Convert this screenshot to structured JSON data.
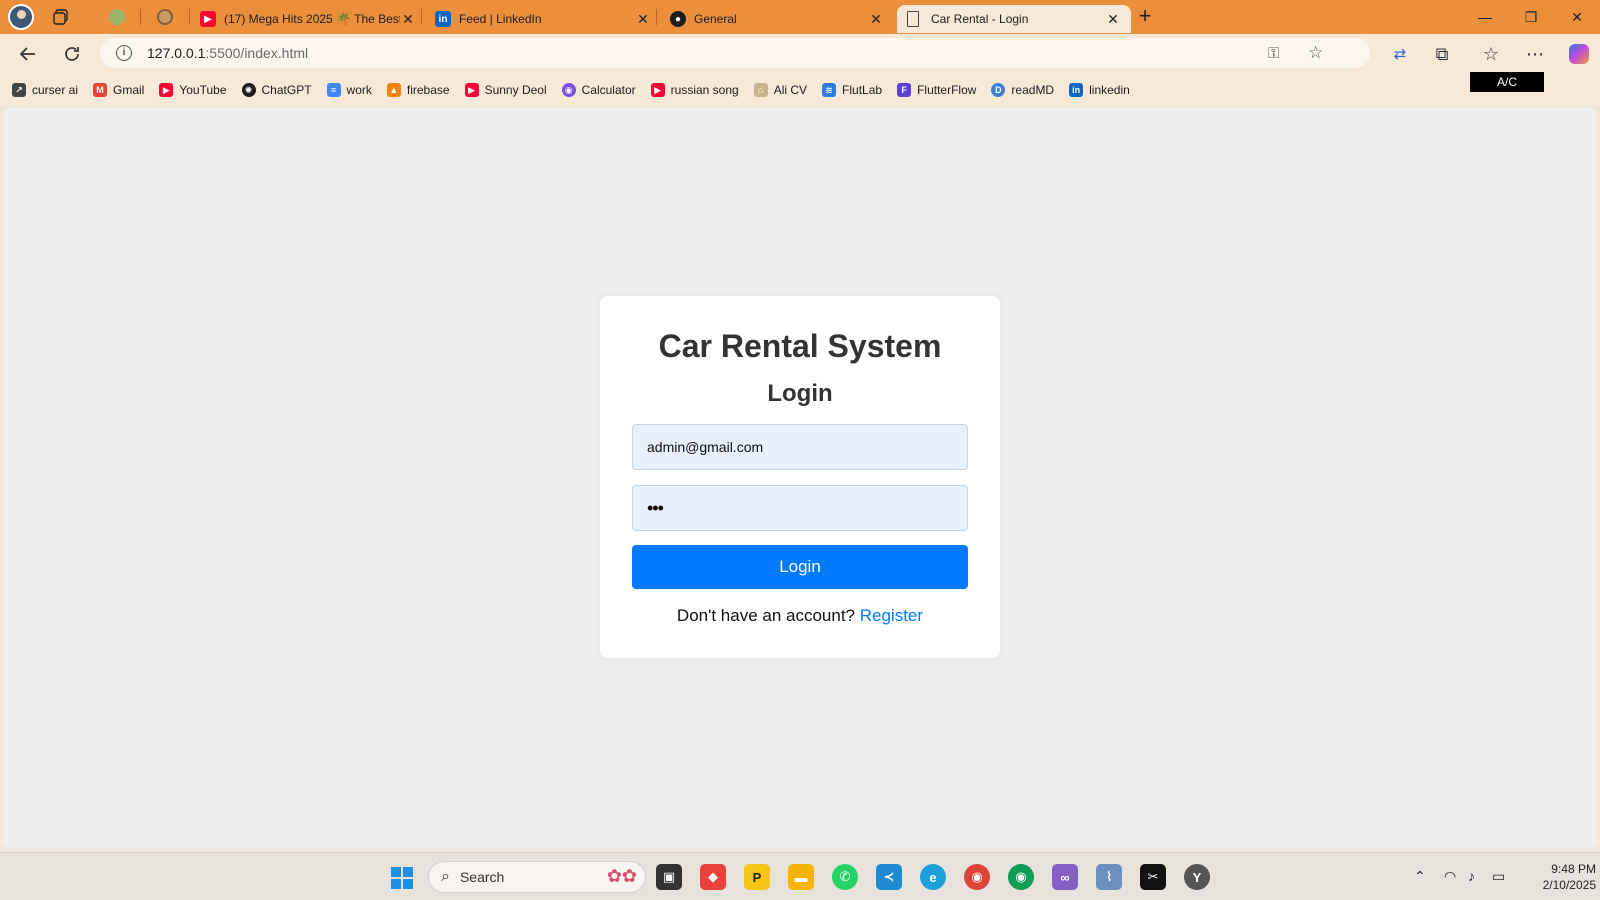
{
  "browser": {
    "tabs": [
      {
        "title": "(17) Mega Hits 2025 🌴 The Best",
        "icon": "youtube-icon"
      },
      {
        "title": "Feed | LinkedIn",
        "icon": "linkedin-icon"
      },
      {
        "title": "General",
        "icon": "github-icon"
      },
      {
        "title": "Car Rental - Login",
        "icon": "page-icon",
        "active": true
      }
    ],
    "url": {
      "host": "127.0.0.1",
      "path": ":5500/index.html"
    },
    "bookmarks": [
      {
        "label": "curser ai",
        "icon": "cursor-icon"
      },
      {
        "label": "Gmail",
        "icon": "gmail-icon"
      },
      {
        "label": "YouTube",
        "icon": "youtube-icon"
      },
      {
        "label": "ChatGPT",
        "icon": "chatgpt-icon"
      },
      {
        "label": "work",
        "icon": "docs-icon"
      },
      {
        "label": "firebase",
        "icon": "firebase-icon"
      },
      {
        "label": "Sunny Deol",
        "icon": "youtube-icon"
      },
      {
        "label": "Calculator",
        "icon": "calculator-icon"
      },
      {
        "label": "russian song",
        "icon": "youtube-icon"
      },
      {
        "label": "Ali CV",
        "icon": "cv-icon"
      },
      {
        "label": "FlutLab",
        "icon": "flutlab-icon"
      },
      {
        "label": "FlutterFlow",
        "icon": "flutterflow-icon"
      },
      {
        "label": "readMD",
        "icon": "readmd-icon"
      },
      {
        "label": "linkedin",
        "icon": "linkedin-icon"
      }
    ],
    "overlay_badge": "A/C",
    "accent_color": "#ec8f3c"
  },
  "page": {
    "title": "Car Rental System",
    "subtitle": "Login",
    "email_value": "admin@gmail.com",
    "password_value": "•••",
    "login_button": "Login",
    "register_prompt": "Don't have an account?",
    "register_link": "Register",
    "button_color": "#007bff"
  },
  "taskbar": {
    "search_placeholder": "Search",
    "time": "9:48 PM",
    "date": "2/10/2025"
  }
}
